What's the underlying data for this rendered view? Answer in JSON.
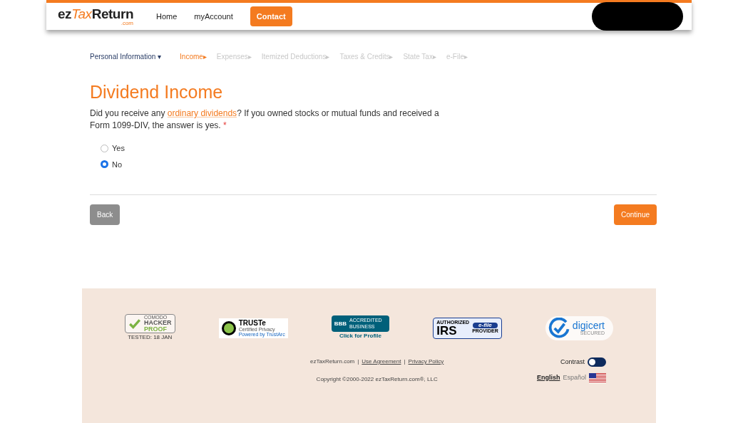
{
  "header": {
    "logo": {
      "main": "ez",
      "accent": "Tax",
      "tail": "Return",
      "sub": ".com"
    },
    "nav": [
      {
        "label": "Home",
        "kind": "link"
      },
      {
        "label": "myAccount",
        "kind": "link"
      },
      {
        "label": "Contact",
        "kind": "button"
      }
    ],
    "redacted": true
  },
  "steps": [
    {
      "label": "Personal Information",
      "kind": "done",
      "marker": "▾"
    },
    {
      "label": "Income",
      "kind": "current",
      "marker": "▸"
    },
    {
      "label": "Expenses",
      "kind": "todo",
      "marker": "▸"
    },
    {
      "label": "Itemized Deductions",
      "kind": "todo",
      "marker": "▸"
    },
    {
      "label": "Taxes & Credits",
      "kind": "todo",
      "marker": "▸"
    },
    {
      "label": "State Tax",
      "kind": "todo",
      "marker": "▸"
    },
    {
      "label": "e-File",
      "kind": "todo",
      "marker": "▸"
    }
  ],
  "title": "Dividend Income",
  "question": {
    "before": "Did you receive any ",
    "link": "ordinary dividends",
    "after": "? If you owned stocks or mutual funds and received a Form 1099-DIV, the answer is yes.",
    "required": "*"
  },
  "options": [
    {
      "label": "Yes",
      "selected": false
    },
    {
      "label": "No",
      "selected": true
    }
  ],
  "buttons": {
    "back": "Back",
    "continue": "Continue"
  },
  "badges": [
    {
      "kind": "hacker",
      "lines": [
        "COMODO",
        "HACKER",
        "PROOF",
        "TESTED: 18 JAN"
      ]
    },
    {
      "kind": "truste",
      "lines": [
        "TRUSTe",
        "Certified Privacy",
        "Powered by TrustArc"
      ]
    },
    {
      "kind": "bbb",
      "lines": [
        "BBB",
        "ACCREDITED BUSINESS",
        "Click for Profile"
      ]
    },
    {
      "kind": "irs",
      "lines": [
        "AUTHORIZED",
        "IRS",
        "e-file",
        "PROVIDER"
      ]
    },
    {
      "kind": "digicert",
      "lines": [
        "digicert",
        "SECURED"
      ]
    }
  ],
  "footer": {
    "site": "ezTaxReturn.com",
    "separator": "|",
    "links": [
      "Use Agreement",
      "Privacy Policy"
    ],
    "copyright": "Copyright ©2000-2022 ezTaxReturn.com®, LLC",
    "contrast": {
      "label": "Contrast",
      "on": false
    },
    "languages": [
      {
        "label": "English",
        "selected": true
      },
      {
        "label": "Español",
        "selected": false
      }
    ]
  }
}
